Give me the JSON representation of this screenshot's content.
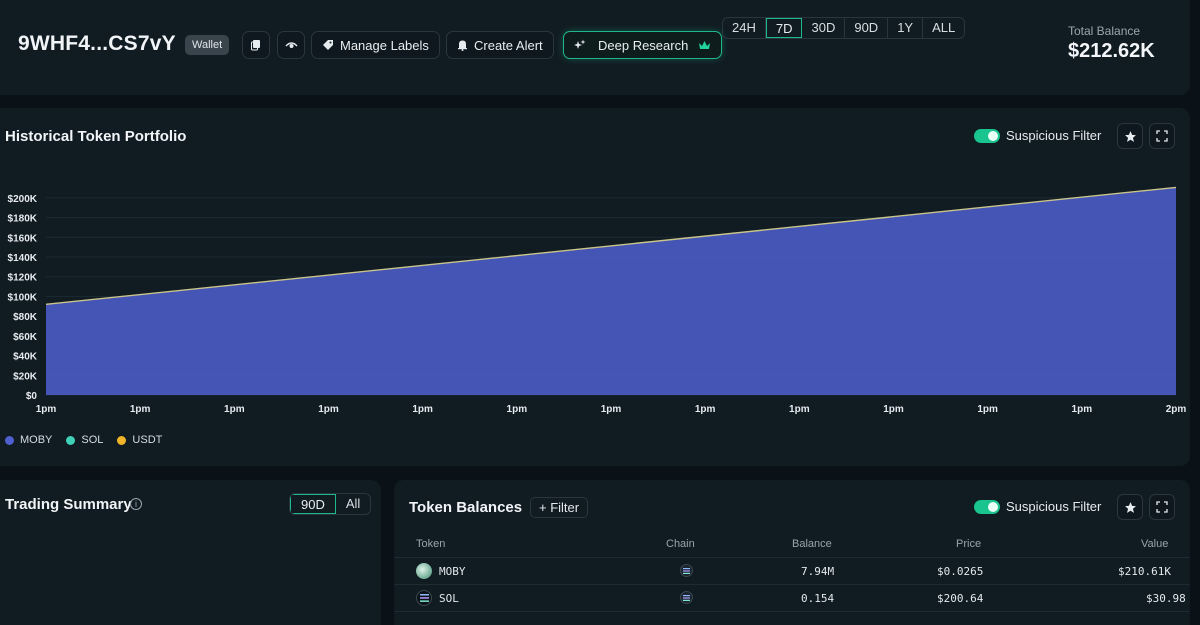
{
  "header": {
    "wallet_address": "9WHF4...CS7vY",
    "wallet_badge": "Wallet",
    "manage_labels": "Manage Labels",
    "create_alert": "Create Alert",
    "deep_research": "Deep Research",
    "total_balance_label": "Total Balance",
    "total_balance_value": "$212.62K"
  },
  "portfolio": {
    "title": "Historical Token Portfolio",
    "ranges": [
      "24H",
      "7D",
      "30D",
      "90D",
      "1Y",
      "ALL"
    ],
    "active_range": "7D",
    "suspicious_filter_label": "Suspicious Filter",
    "suspicious_filter_on": true
  },
  "chart_data": {
    "type": "area",
    "title": "",
    "xlabel": "",
    "ylabel": "",
    "x_ticks": [
      "1pm",
      "1pm",
      "1pm",
      "1pm",
      "1pm",
      "1pm",
      "1pm",
      "1pm",
      "1pm",
      "1pm",
      "1pm",
      "1pm",
      "2pm"
    ],
    "y_ticks": [
      "$0",
      "$20K",
      "$40K",
      "$60K",
      "$80K",
      "$100K",
      "$120K",
      "$140K",
      "$160K",
      "$180K",
      "$200K"
    ],
    "ylim": [
      0,
      210000
    ],
    "series": [
      {
        "name": "MOBY",
        "color": "#4f5fd0",
        "start": 92000,
        "end": 210610
      },
      {
        "name": "SOL",
        "color": "#3ed0b8",
        "start": 30,
        "end": 31
      },
      {
        "name": "USDT",
        "color": "#f0b429",
        "start": 0,
        "end": 0
      }
    ],
    "grid": true,
    "legend": "bottom-left"
  },
  "trading_summary": {
    "title": "Trading Summary",
    "ranges": [
      "90D",
      "All"
    ],
    "active_range": "90D"
  },
  "token_balances": {
    "title": "Token Balances",
    "filter_label": "Filter",
    "suspicious_filter_label": "Suspicious Filter",
    "columns": [
      "Token",
      "Chain",
      "Balance",
      "Price",
      "Value"
    ],
    "rows": [
      {
        "token": "MOBY",
        "balance": "7.94M",
        "price": "$0.0265",
        "value": "$210.61K"
      },
      {
        "token": "SOL",
        "balance": "0.154",
        "price": "$200.64",
        "value": "$30.98"
      }
    ]
  }
}
